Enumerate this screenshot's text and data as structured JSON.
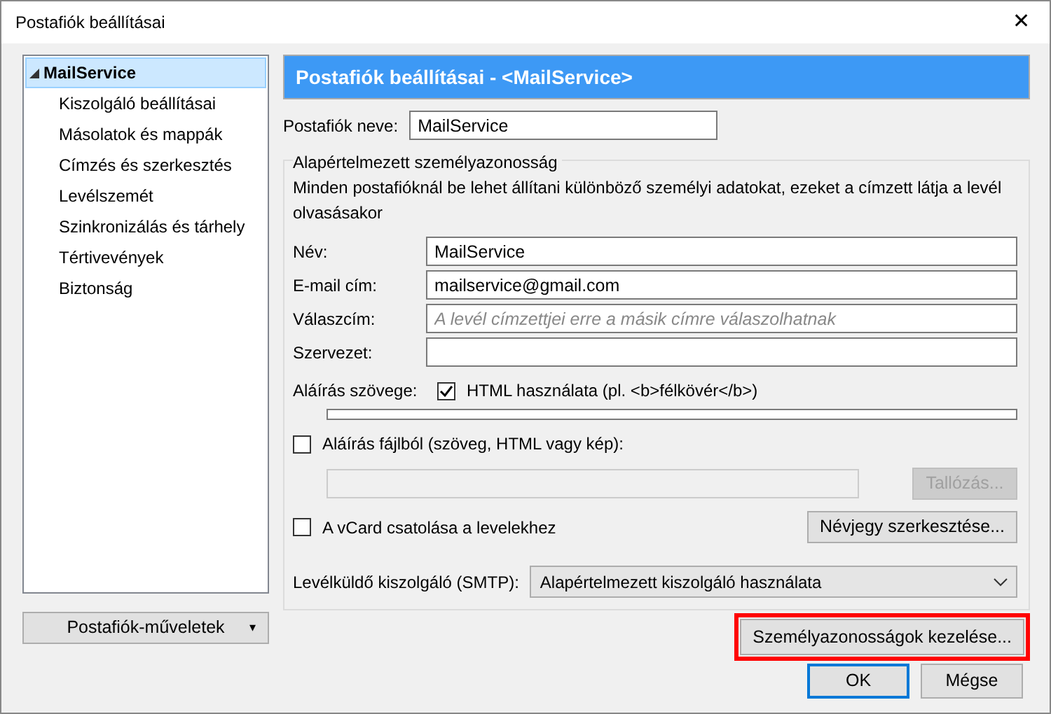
{
  "window": {
    "title": "Postafiók beállításai",
    "close": "✕"
  },
  "sidebar": {
    "items": [
      {
        "label": "MailService",
        "selected": true,
        "expanded": true,
        "children": [
          {
            "label": "Kiszolgáló beállításai",
            "selected": false
          },
          {
            "label": "Másolatok és mappák",
            "selected": false
          },
          {
            "label": "Címzés és szerkesztés",
            "selected": false
          },
          {
            "label": "Levélszemét",
            "selected": false
          },
          {
            "label": "Szinkronizálás és tárhely",
            "selected": false
          },
          {
            "label": "Tértivevények",
            "selected": false
          },
          {
            "label": "Biztonság",
            "selected": false
          }
        ]
      }
    ],
    "actions_button": {
      "label": "Postafiók-műveletek",
      "caret": "▾"
    }
  },
  "header": "Postafiók beállításai - <MailService>",
  "account_name": {
    "label": "Postafiók neve:",
    "value": "MailService"
  },
  "identity": {
    "legend": "Alapértelmezett személyazonosság",
    "description": "Minden postafióknál be lehet állítani különböző személyi adatokat, ezeket a címzett látja a levél olvasásakor",
    "fields": [
      {
        "label": "Név:",
        "value": "MailService"
      },
      {
        "label": "E-mail cím:",
        "value": "mailservice@gmail.com"
      },
      {
        "label": "Válaszcím:",
        "placeholder": "A levél címzettjei erre a másik címre válaszolhatnak"
      },
      {
        "label": "Szervezet:"
      }
    ],
    "signature_label": "Aláírás szövege:",
    "html_checkbox": {
      "label": "HTML használata (pl. <b>félkövér</b>)",
      "checked": true
    },
    "file_checkbox": {
      "label": "Aláírás fájlból (szöveg, HTML vagy kép):",
      "checked": false
    },
    "browse_button": {
      "label": "Tallózás...",
      "disabled": true
    },
    "vcard_checkbox": {
      "label": "A vCard csatolása a levelekhez",
      "checked": false
    },
    "vcard_button": "Névjegy szerkesztése...",
    "smtp": {
      "label": "Levélküldő kiszolgáló (SMTP):",
      "value": "Alapértelmezett kiszolgáló használata"
    }
  },
  "identities_button": {
    "label": "Személyazonosságok kezelése...",
    "highlighted": true
  },
  "buttons": [
    {
      "label": "OK",
      "default": true
    },
    {
      "label": "Mégse",
      "default": false
    }
  ]
}
